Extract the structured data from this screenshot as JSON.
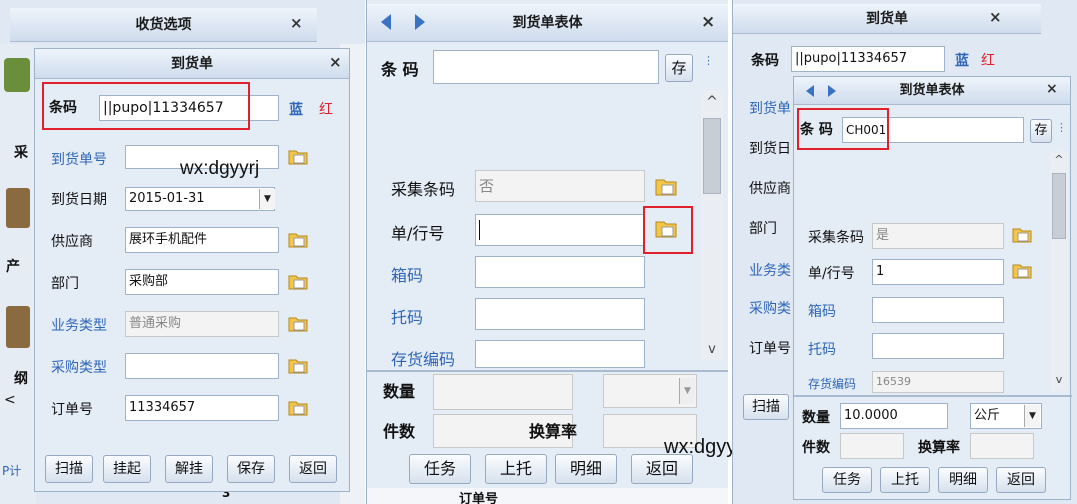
{
  "panel1": {
    "outer_title": "收货选项",
    "dialog_title": "到货单",
    "close": "×",
    "barcode_label": "条码",
    "barcode_value": "||pupo|11334657",
    "blue_btn": "蓝",
    "red_btn": "红",
    "fields": [
      {
        "label": "到货单号",
        "value": ""
      },
      {
        "label": "到货日期",
        "value": "2015-01-31"
      },
      {
        "label": "供应商",
        "value": "展环手机配件"
      },
      {
        "label": "部门",
        "value": "采购部"
      },
      {
        "label": "业务类型",
        "value": "普通采购"
      },
      {
        "label": "采购类型",
        "value": ""
      },
      {
        "label": "订单号",
        "value": "11334657"
      }
    ],
    "buttons": [
      "扫描",
      "挂起",
      "解挂",
      "保存",
      "返回"
    ],
    "side_labels": [
      "采",
      "产",
      "纲",
      "P计"
    ],
    "bottom_stub": "3",
    "left_arrow": "<"
  },
  "panel2": {
    "title": "到货单表体",
    "close": "×",
    "barcode_label": "条 码",
    "barcode_value": "",
    "save_btn": "存",
    "fields": [
      {
        "label": "采集条码",
        "value": "否"
      },
      {
        "label": "单/行号",
        "value": ""
      },
      {
        "label": "箱码",
        "value": ""
      },
      {
        "label": "托码",
        "value": ""
      },
      {
        "label": "存货编码",
        "value": ""
      }
    ],
    "qty_label": "数量",
    "pieces_label": "件数",
    "rate_label": "换算率",
    "buttons": [
      "任务",
      "上托",
      "明细",
      "返回"
    ],
    "bottom_stub": "订单号"
  },
  "panel3": {
    "outer_title": "到货单",
    "close": "×",
    "barcode_label": "条码",
    "barcode_value": "||pupo|11334657",
    "blue_btn": "蓝",
    "red_btn": "红",
    "bg_labels": [
      "到货单",
      "到货日",
      "供应商",
      "部门",
      "业务类",
      "采购类",
      "订单号"
    ],
    "inner_title": "到货单表体",
    "inner_barcode_label": "条 码",
    "inner_barcode_value": "CH001",
    "save_btn": "存",
    "fields": [
      {
        "label": "采集条码",
        "value": "是"
      },
      {
        "label": "单/行号",
        "value": "1"
      },
      {
        "label": "箱码",
        "value": ""
      },
      {
        "label": "托码",
        "value": ""
      },
      {
        "label": "存货编码",
        "value": "16539"
      }
    ],
    "scan_btn": "扫描",
    "qty_label": "数量",
    "qty_value": "10.0000",
    "unit_value": "公斤",
    "pieces_label": "件数",
    "rate_label": "换算率",
    "buttons": [
      "任务",
      "上托",
      "明细",
      "返回"
    ]
  },
  "watermark1": "wx:dgyyrj",
  "watermark2": "wx:dgyyrj",
  "colors": {
    "highlight": "#e0212b",
    "label_blue": "#2f66b8",
    "title_grad": "#cfdced"
  }
}
